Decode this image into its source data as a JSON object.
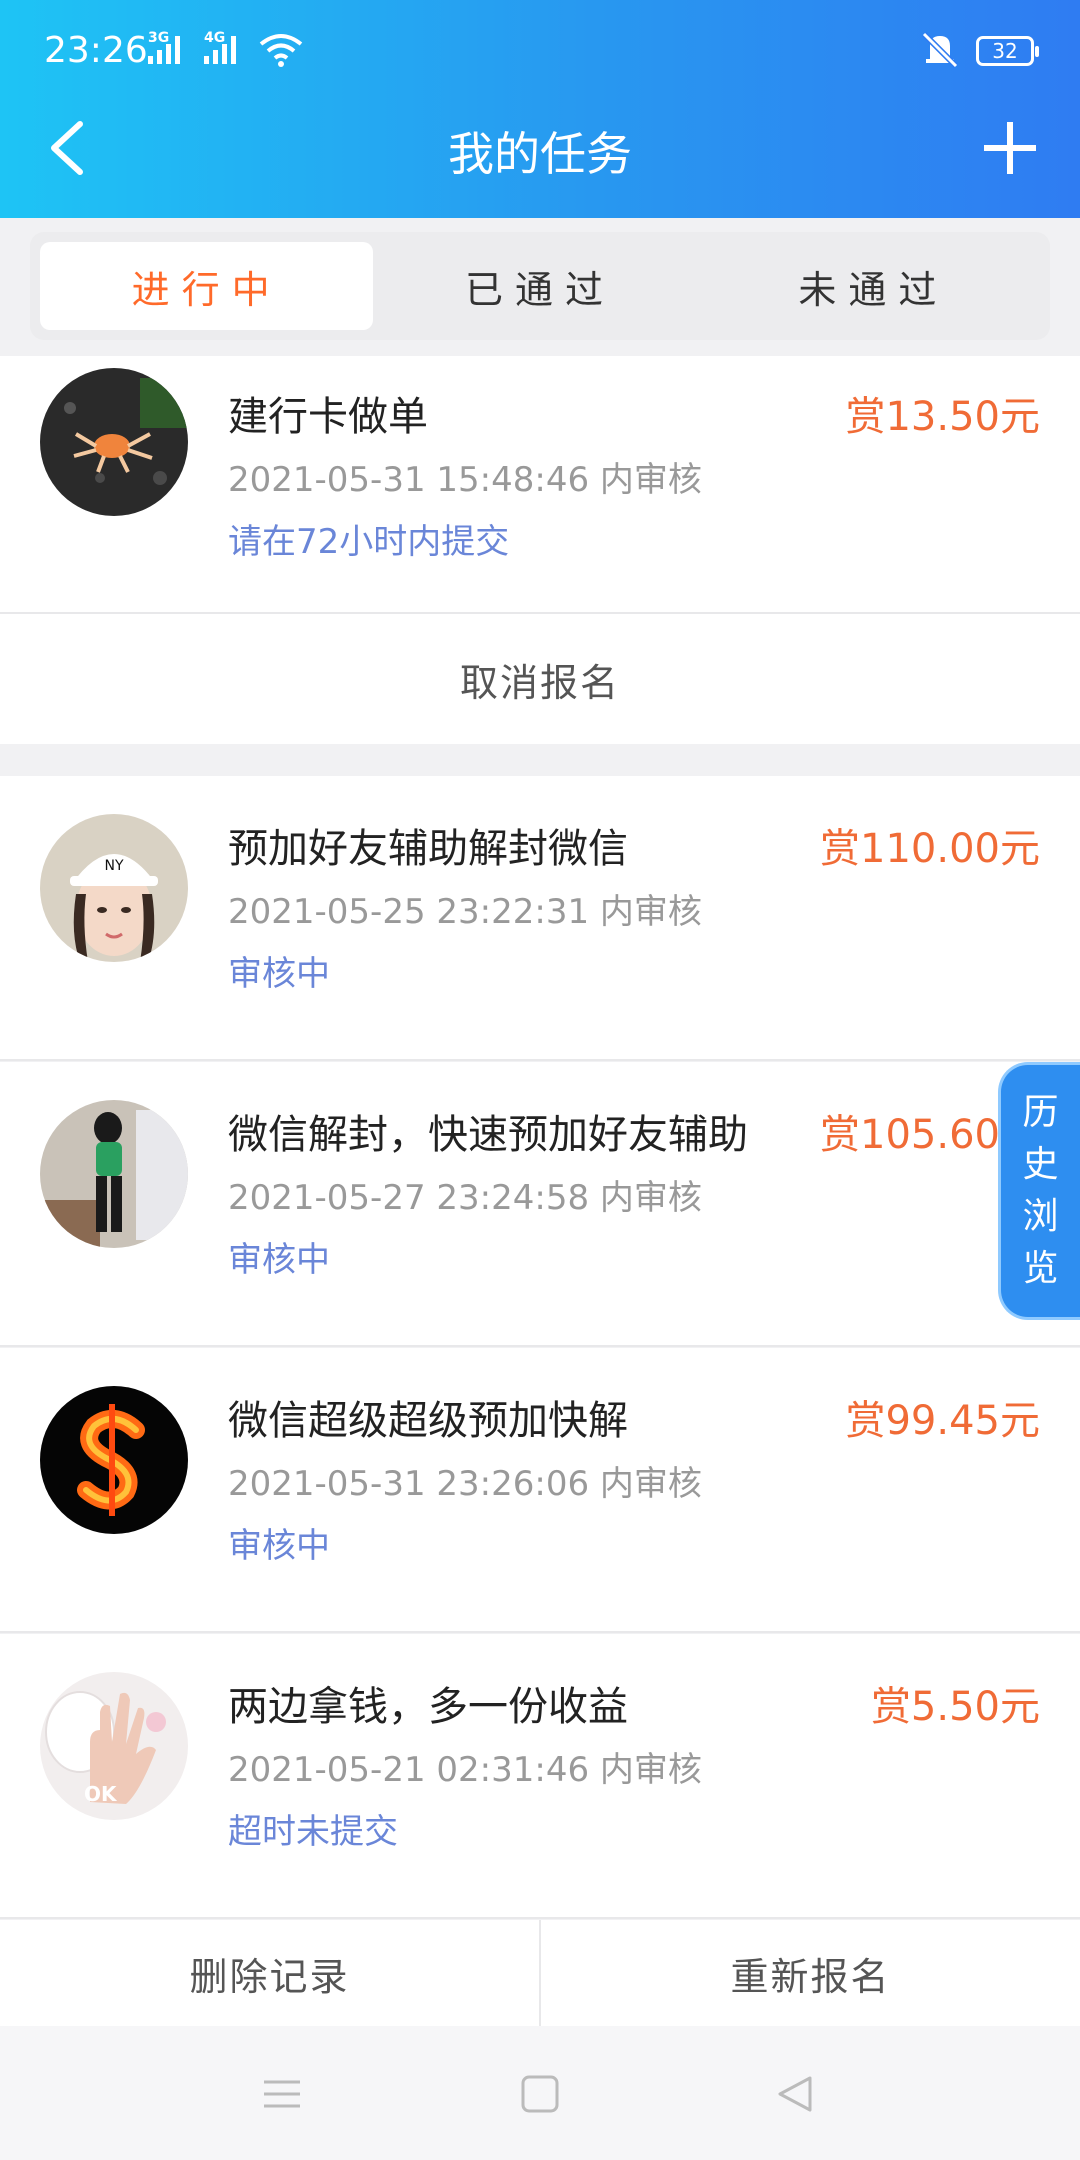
{
  "status_bar": {
    "time": "23:26",
    "signal1_label": "3G",
    "signal2_label": "4G",
    "battery": "32"
  },
  "header": {
    "title": "我的任务"
  },
  "tabs": [
    {
      "label": "进行中",
      "active": true
    },
    {
      "label": "已通过",
      "active": false
    },
    {
      "label": "未通过",
      "active": false
    }
  ],
  "tasks": [
    {
      "name": "建行卡做单",
      "price": "赏13.50元",
      "time": "2021-05-31 15:48:46 内审核",
      "status": "请在72小时内提交"
    },
    {
      "name": "预加好友辅助解封微信",
      "price": "赏110.00元",
      "time": "2021-05-25 23:22:31 内审核",
      "status": "审核中"
    },
    {
      "name": "微信解封，快速预加好友辅助",
      "price": "赏105.60",
      "time": "2021-05-27 23:24:58 内审核",
      "status": "审核中"
    },
    {
      "name": "微信超级超级预加快解",
      "price": "赏99.45元",
      "time": "2021-05-31 23:26:06 内审核",
      "status": "审核中"
    },
    {
      "name": "两边拿钱，多一份收益",
      "price": "赏5.50元",
      "time": "2021-05-21 02:31:46 内审核",
      "status": "超时未提交"
    }
  ],
  "actions": {
    "cancel": "取消报名",
    "delete": "删除记录",
    "reapply": "重新报名"
  },
  "history_button": [
    "历",
    "史",
    "浏",
    "览"
  ],
  "avatar_text": "OK",
  "colors": {
    "header_start": "#1ec4f5",
    "header_end": "#2f7cf2",
    "price": "#f06b36",
    "status": "#6a86d8",
    "active_tab": "#ff6a2a"
  }
}
